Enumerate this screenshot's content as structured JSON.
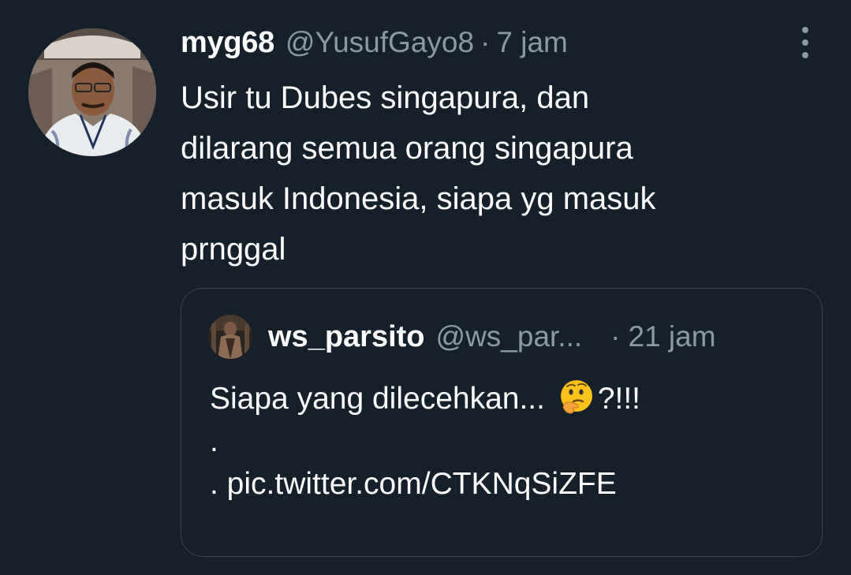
{
  "tweet": {
    "display_name": "myg68",
    "handle": "@YusufGayo8",
    "separator": "·",
    "time": "7 jam",
    "avatar_icon": "profile-photo",
    "more_icon": "more-vertical-icon",
    "text_lines": [
      "Usir tu Dubes singapura, dan",
      "dilarang semua orang singapura",
      "masuk Indonesia, siapa yg masuk",
      "prnggal"
    ]
  },
  "quoted_tweet": {
    "display_name": "ws_parsito",
    "handle": "@ws_par...",
    "separator": "·",
    "time": "21 jam",
    "avatar_icon": "profile-photo",
    "line1_before_emoji": "Siapa yang dilecehkan... ",
    "emoji": "thinking-face-emoji",
    "line1_after_emoji": "?!!!",
    "line2": ".",
    "line3": ". pic.twitter.com/CTKNqSiZFE"
  },
  "colors": {
    "background": "#15202b",
    "text_primary": "#ffffff",
    "text_secondary": "#8b98a5",
    "border": "#38444d"
  }
}
